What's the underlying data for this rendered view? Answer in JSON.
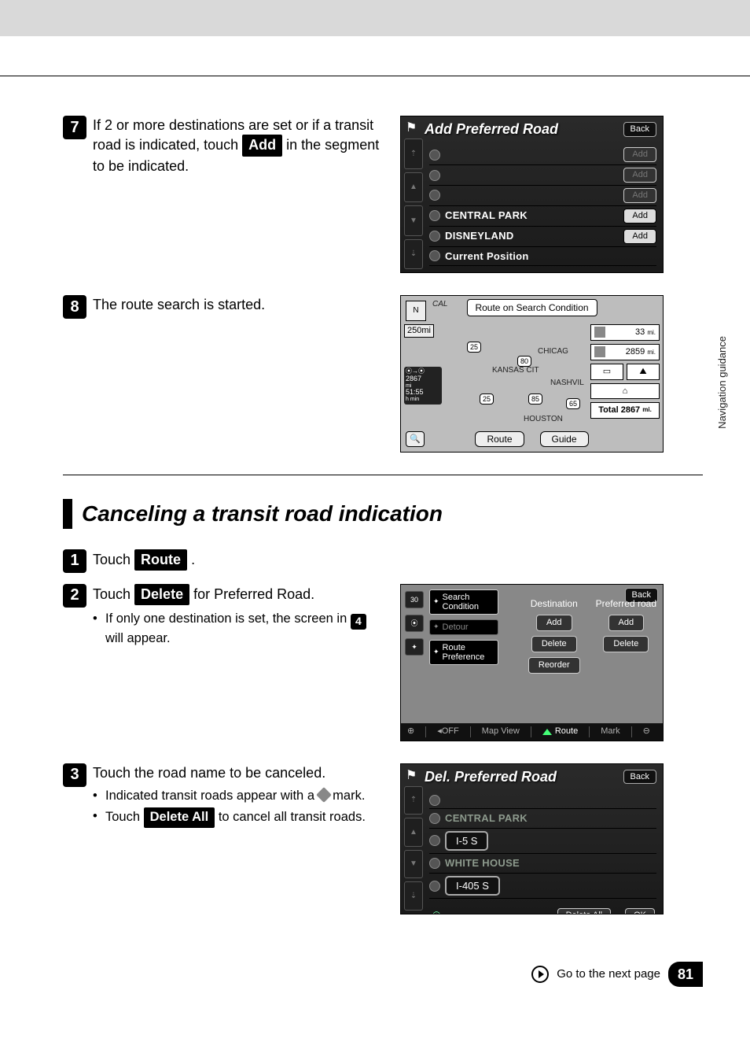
{
  "sideTab": "Navigation\nguidance",
  "step7": {
    "num": "7",
    "text_a": "If 2 or more destinations are set or if a transit road is indicated, touch ",
    "btn": "Add",
    "text_b": " in the segment to be indicated."
  },
  "step8": {
    "num": "8",
    "text": "The route search is started."
  },
  "heading": "Canceling a transit road indication",
  "cstep1": {
    "num": "1",
    "text_a": "Touch ",
    "btn": "Route",
    "text_b": " ."
  },
  "cstep2": {
    "num": "2",
    "text_a": "Touch ",
    "btn": "Delete",
    "text_b": " for Preferred Road.",
    "bullet_a": "If only one destination is set, the screen in ",
    "bullet_num": "4",
    "bullet_b": " will appear."
  },
  "cstep3": {
    "num": "3",
    "text": "Touch the road name to be canceled.",
    "bullet1_a": "Indicated transit roads appear with a ",
    "bullet1_b": " mark.",
    "bullet2_a": "Touch ",
    "bullet2_btn": "Delete All",
    "bullet2_b": " to cancel all transit roads."
  },
  "screen_add": {
    "title": "Add Preferred Road",
    "back": "Back",
    "items": [
      {
        "label": "",
        "btn": "Add",
        "dim": true
      },
      {
        "label": "",
        "btn": "Add",
        "dim": true
      },
      {
        "label": "",
        "btn": "Add",
        "dim": true
      },
      {
        "label": "CENTRAL PARK",
        "btn": "Add"
      },
      {
        "label": "DISNEYLAND",
        "btn": "Add"
      },
      {
        "label": "Current Position"
      }
    ]
  },
  "screen_map": {
    "topLabel": "Route on Search Condition",
    "scale": "250mi",
    "left": {
      "top": "2867",
      "topUnit": "mi",
      "time": "51:55",
      "timeUnit": "h  min"
    },
    "info": [
      {
        "value": "33",
        "unit": "mi."
      },
      {
        "value": "2859",
        "unit": "mi."
      }
    ],
    "total": "Total 2867",
    "totalUnit": "mi.",
    "routeBtn": "Route",
    "guideBtn": "Guide",
    "cities": [
      "CHICAG",
      "KANSAS CIT",
      "NASHVIL",
      "HOUSTON"
    ],
    "shields": [
      "25",
      "80",
      "25",
      "85",
      "65"
    ],
    "cal": "CAL"
  },
  "screen_route": {
    "back": "Back",
    "menu": [
      "Search\nCondition",
      "Detour",
      "Route\nPreference"
    ],
    "cols": [
      {
        "title": "Destination",
        "btns": [
          "Add",
          "Delete",
          "Reorder"
        ]
      },
      {
        "title": "Preferred road",
        "btns": [
          "Add",
          "Delete"
        ]
      }
    ],
    "bottom": [
      "OFF",
      "Map View",
      "Route",
      "Mark"
    ],
    "leftScale": "30"
  },
  "screen_del": {
    "title": "Del. Preferred Road",
    "back": "Back",
    "items": [
      {
        "label": ""
      },
      {
        "label": "CENTRAL PARK",
        "dim": true
      },
      {
        "label": "I-5 S",
        "road": true
      },
      {
        "label": "WHITE HOUSE",
        "dim": true
      },
      {
        "label": "I-405 S",
        "road": true
      }
    ],
    "deleteAll": "Delete All",
    "ok": "OK"
  },
  "footer": {
    "text": "Go to the next page",
    "page": "81"
  }
}
